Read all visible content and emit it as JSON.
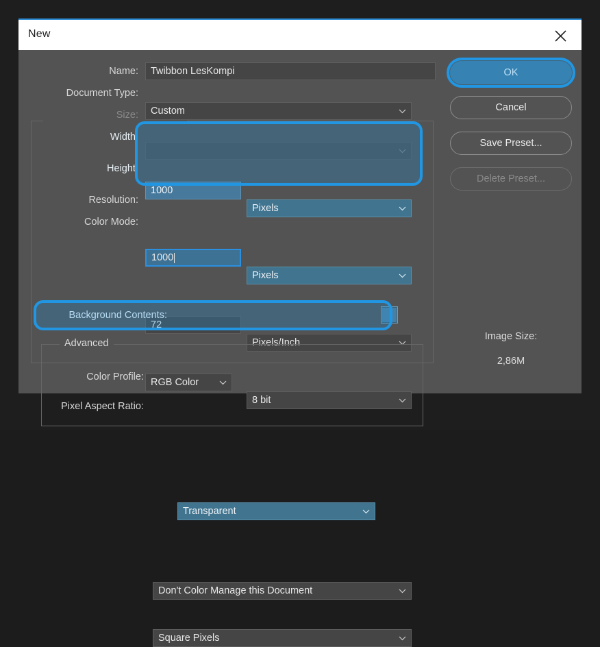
{
  "window": {
    "title": "New",
    "close_icon": "close-icon"
  },
  "form": {
    "name": {
      "label": "Name:",
      "value": "Twibbon LesKompi"
    },
    "document_type": {
      "label": "Document Type:",
      "value": "Custom"
    },
    "size": {
      "label": "Size:",
      "value": "",
      "disabled": true
    },
    "width": {
      "label": "Width:",
      "value": "1000",
      "unit": "Pixels"
    },
    "height": {
      "label": "Height:",
      "value": "1000",
      "unit": "Pixels"
    },
    "resolution": {
      "label": "Resolution:",
      "value": "72",
      "unit": "Pixels/Inch"
    },
    "color_mode": {
      "label": "Color Mode:",
      "value": "RGB Color",
      "depth": "8 bit"
    },
    "background_contents": {
      "label": "Background Contents:",
      "value": "Transparent"
    },
    "advanced": {
      "legend": "Advanced",
      "color_profile": {
        "label": "Color Profile:",
        "value": "Don't Color Manage this Document"
      },
      "pixel_aspect_ratio": {
        "label": "Pixel Aspect Ratio:",
        "value": "Square Pixels"
      }
    }
  },
  "buttons": {
    "ok": "OK",
    "cancel": "Cancel",
    "save_preset": "Save Preset...",
    "delete_preset": "Delete Preset..."
  },
  "image_size": {
    "label": "Image Size:",
    "value": "2,86M"
  },
  "colors": {
    "highlight": "#2196e3",
    "dialog_bg": "#535353",
    "field_bg": "#454545",
    "titlebar_bg": "#ffffff",
    "accent_line": "#2f8fd8"
  }
}
